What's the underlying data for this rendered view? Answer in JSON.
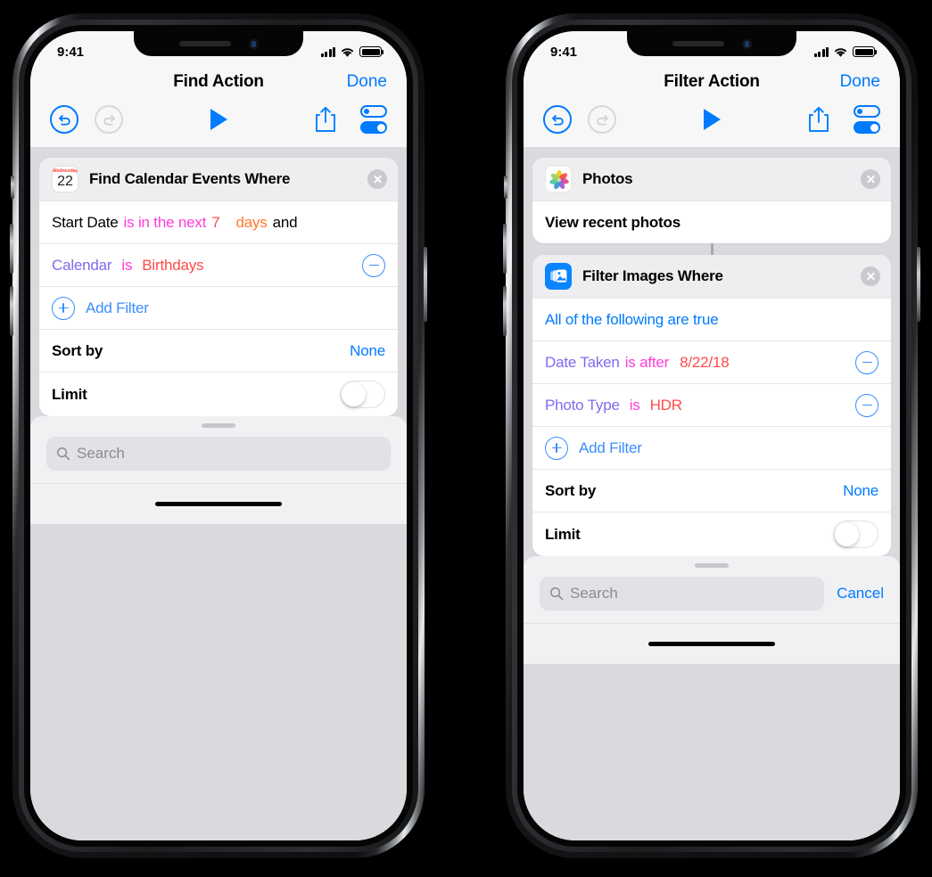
{
  "phones": [
    {
      "id": "find-action",
      "statusbar": {
        "time": "9:41",
        "signal_icon": "cellular-bars-icon",
        "wifi_icon": "wifi-icon",
        "battery_icon": "battery-full-icon"
      },
      "navbar": {
        "title": "Find Action",
        "done_label": "Done"
      },
      "toolbar": {
        "undo": "undo-icon",
        "redo": "redo-icon",
        "play": "play-icon",
        "share": "share-icon",
        "settings": "toggles-icon"
      },
      "cards": [
        {
          "icon": "calendar-icon",
          "icon_day": "Wednesday",
          "icon_date": "22",
          "title": "Find Calendar Events Where",
          "close": "close-icon",
          "rows": [
            {
              "type": "filter",
              "tokens": [
                {
                  "text": "Start Date",
                  "color": "black"
                },
                {
                  "text": "is in the next",
                  "color": "magenta"
                },
                {
                  "text": "7",
                  "color": "red"
                },
                {
                  "text": "days",
                  "color": "orange"
                },
                {
                  "text": "and",
                  "color": "black"
                }
              ],
              "remove": null
            },
            {
              "type": "filter",
              "tokens": [
                {
                  "text": "Calendar",
                  "color": "purple"
                },
                {
                  "text": "is",
                  "color": "magenta"
                },
                {
                  "text": "Birthdays",
                  "color": "red"
                }
              ],
              "remove": "minus-icon"
            },
            {
              "type": "add",
              "label": "Add Filter",
              "icon": "plus-icon"
            },
            {
              "type": "sort",
              "label": "Sort by",
              "value": "None"
            },
            {
              "type": "limit",
              "label": "Limit",
              "toggle": "off"
            }
          ]
        }
      ],
      "bottom": {
        "search_placeholder": "Search",
        "search_value": "",
        "search_icon": "search-icon",
        "cancel_label": null
      }
    },
    {
      "id": "filter-action",
      "statusbar": {
        "time": "9:41",
        "signal_icon": "cellular-bars-icon",
        "wifi_icon": "wifi-icon",
        "battery_icon": "battery-full-icon"
      },
      "navbar": {
        "title": "Filter Action",
        "done_label": "Done"
      },
      "toolbar": {
        "undo": "undo-icon",
        "redo": "redo-icon",
        "play": "play-icon",
        "share": "share-icon",
        "settings": "toggles-icon"
      },
      "cards": [
        {
          "icon": "photos-icon",
          "title": "Photos",
          "close": "close-icon",
          "rows": [
            {
              "type": "plain",
              "label": "View recent photos"
            }
          ]
        },
        {
          "icon": "filter-images-icon",
          "title": "Filter Images Where",
          "close": "close-icon",
          "rows": [
            {
              "type": "condition",
              "label": "All of the following are true"
            },
            {
              "type": "filter",
              "tokens": [
                {
                  "text": "Date Taken",
                  "color": "purple"
                },
                {
                  "text": "is after",
                  "color": "magenta"
                },
                {
                  "text": "8/22/18",
                  "color": "red"
                }
              ],
              "remove": "minus-icon"
            },
            {
              "type": "filter",
              "tokens": [
                {
                  "text": "Photo Type",
                  "color": "purple"
                },
                {
                  "text": "is",
                  "color": "magenta"
                },
                {
                  "text": "HDR",
                  "color": "red"
                }
              ],
              "remove": "minus-icon"
            },
            {
              "type": "add",
              "label": "Add Filter",
              "icon": "plus-icon"
            },
            {
              "type": "sort",
              "label": "Sort by",
              "value": "None"
            },
            {
              "type": "limit",
              "label": "Limit",
              "toggle": "off"
            }
          ]
        }
      ],
      "bottom": {
        "search_placeholder": "Search",
        "search_value": "",
        "search_icon": "search-icon",
        "cancel_label": "Cancel"
      }
    }
  ],
  "colors": {
    "accent_blue": "#007aff",
    "token_purple": "#7d6cf0",
    "token_magenta": "#ff3ddb",
    "token_red": "#ff4a4a",
    "token_orange": "#ff7a29",
    "card_header": "#eeeef0",
    "content_bg": "#d9d9de"
  }
}
